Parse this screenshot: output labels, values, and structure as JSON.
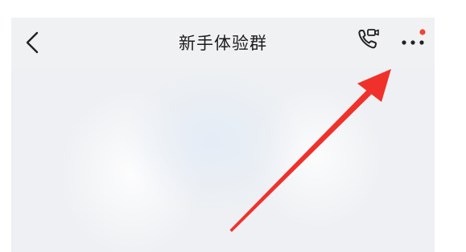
{
  "header": {
    "title": "新手体验群",
    "back_icon": "chevron-left-icon",
    "call_icon": "phone-video-icon",
    "more_icon": "more-dots-icon",
    "notification_dot_color": "#f04438"
  },
  "annotation": {
    "arrow_color": "#f0312b"
  }
}
